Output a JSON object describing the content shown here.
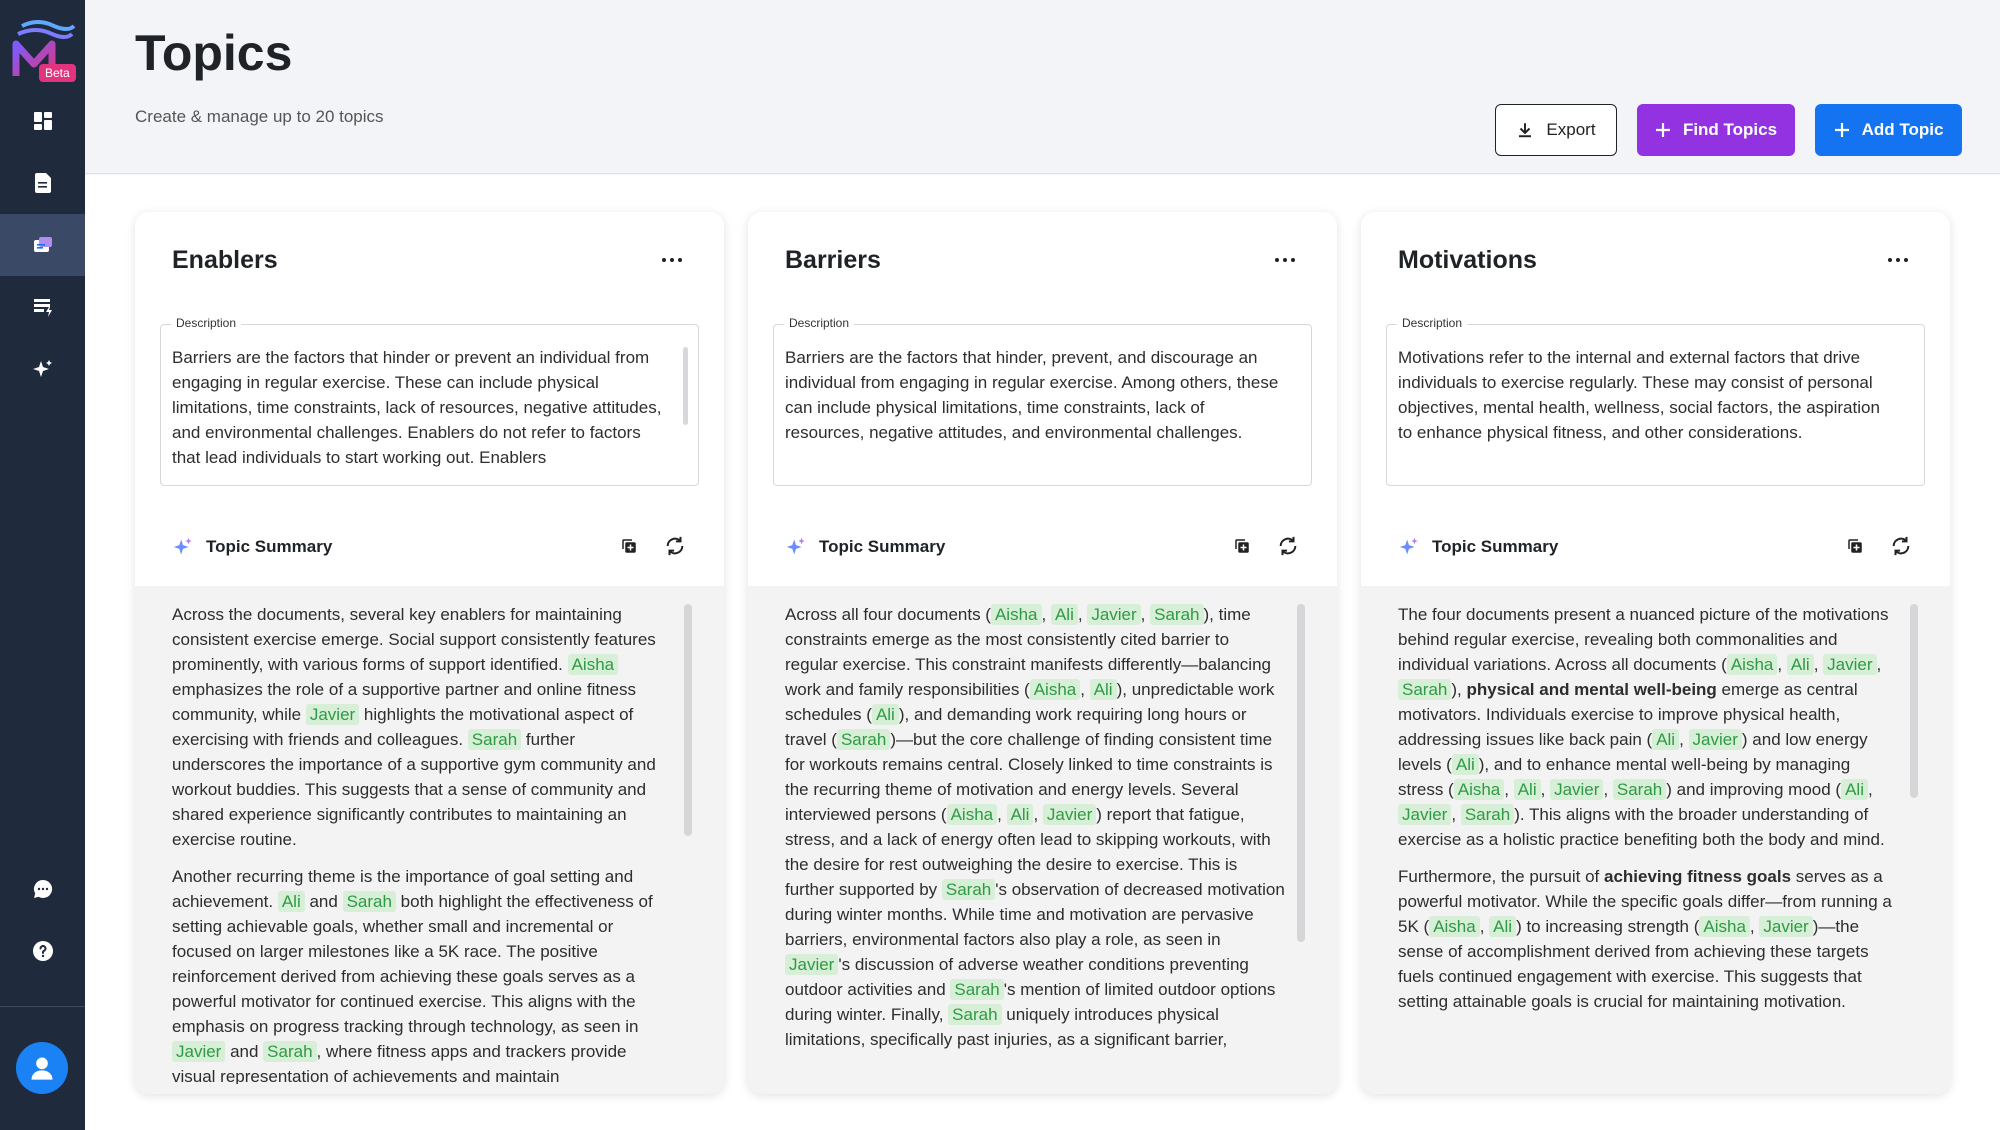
{
  "app": {
    "beta_label": "Beta"
  },
  "sidebar": {
    "items": [
      {
        "name": "dashboard-icon"
      },
      {
        "name": "documents-icon"
      },
      {
        "name": "topics-icon",
        "active": true
      },
      {
        "name": "table-lightning-icon"
      },
      {
        "name": "sparkle-icon"
      }
    ],
    "bottom": [
      {
        "name": "chat-icon"
      },
      {
        "name": "help-icon"
      },
      {
        "name": "user-avatar-icon"
      }
    ]
  },
  "header": {
    "title": "Topics",
    "subtitle": "Create & manage up to 20 topics",
    "export_label": "Export",
    "find_label": "Find Topics",
    "add_label": "Add Topic"
  },
  "colors": {
    "accent_purple": "#9232e0",
    "accent_blue": "#1473f0",
    "tag_bg": "#d7efd6",
    "tag_text": "#2f9a45",
    "sidebar": "#1f2a3d"
  },
  "cards": [
    {
      "title": "Enablers",
      "description_label": "Description",
      "description": "Barriers are the factors that hinder or prevent an individual from engaging in regular exercise. These can include physical limitations, time constraints, lack of resources, negative attitudes, and environmental challenges. Enablers do not refer to factors that lead individuals to start working out. Enablers",
      "summary_label": "Topic Summary",
      "summary_html": "<p>Across the documents, several key enablers for maintaining consistent exercise emerge. Social support consistently features prominently, with various forms of support identified. <span class=\"tag\">Aisha</span> emphasizes the role of a supportive partner and online fitness community, while <span class=\"tag\">Javier</span> highlights the motivational aspect of exercising with friends and colleagues. <span class=\"tag\">Sarah</span> further underscores the importance of a supportive gym community and workout buddies. This suggests that a sense of community and shared experience significantly contributes to maintaining an exercise routine.</p><p>Another recurring theme is the importance of goal setting and achievement. <span class=\"tag\">Ali</span> and <span class=\"tag\">Sarah</span> both highlight the effectiveness of setting achievable goals, whether small and incremental or focused on larger milestones like a 5K race. The positive reinforcement derived from achieving these goals serves as a powerful motivator for continued exercise. This aligns with the emphasis on progress tracking through technology, as seen in <span class=\"tag\">Javier</span> and <span class=\"tag\">Sarah</span>, where fitness apps and trackers provide visual representation of achievements and maintain</p>"
    },
    {
      "title": "Barriers",
      "description_label": "Description",
      "description": "Barriers are the factors that hinder, prevent, and discourage an individual from engaging in regular exercise. Among others, these can include physical limitations, time constraints, lack of resources, negative attitudes, and environmental challenges.",
      "summary_label": "Topic Summary",
      "summary_html": "<p>Across all four documents (<span class=\"tag\">Aisha</span>, <span class=\"tag\">Ali</span>, <span class=\"tag\">Javier</span>, <span class=\"tag\">Sarah</span>), time constraints emerge as the most consistently cited barrier to regular exercise. This constraint manifests differently—balancing work and family responsibilities (<span class=\"tag\">Aisha</span>, <span class=\"tag\">Ali</span>), unpredictable work schedules (<span class=\"tag\">Ali</span>), and demanding work requiring long hours or travel (<span class=\"tag\">Sarah</span>)—but the core challenge of finding consistent time for workouts remains central. Closely linked to time constraints is the recurring theme of motivation and energy levels. Several interviewed persons (<span class=\"tag\">Aisha</span>, <span class=\"tag\">Ali</span>, <span class=\"tag\">Javier</span>) report that fatigue, stress, and a lack of energy often lead to skipping workouts, with the desire for rest outweighing the desire to exercise. This is further supported by <span class=\"tag\">Sarah</span>'s observation of decreased motivation during winter months. While time and motivation are pervasive barriers, environmental factors also play a role, as seen in <span class=\"tag\">Javier</span>'s discussion of adverse weather conditions preventing outdoor activities and <span class=\"tag\">Sarah</span>'s mention of limited outdoor options during winter. Finally, <span class=\"tag\">Sarah</span> uniquely introduces physical limitations, specifically past injuries, as a significant barrier,</p>"
    },
    {
      "title": "Motivations",
      "description_label": "Description",
      "description": "Motivations refer to the internal and external factors that drive individuals to exercise regularly. These may consist of personal objectives, mental health, wellness, social factors, the aspiration to enhance physical fitness, and other considerations.",
      "summary_label": "Topic Summary",
      "summary_html": "<p>The four documents present a nuanced picture of the motivations behind regular exercise, revealing both commonalities and individual variations. Across all documents (<span class=\"tag\">Aisha</span>, <span class=\"tag\">Ali</span>, <span class=\"tag\">Javier</span>, <span class=\"tag\">Sarah</span>), <b>physical and mental well-being</b> emerge as central motivators. Individuals exercise to improve physical health, addressing issues like back pain (<span class=\"tag\">Ali</span>, <span class=\"tag\">Javier</span>) and low energy levels (<span class=\"tag\">Ali</span>), and to enhance mental well-being by managing stress (<span class=\"tag\">Aisha</span>, <span class=\"tag\">Ali</span>, <span class=\"tag\">Javier</span>, <span class=\"tag\">Sarah</span>) and improving mood (<span class=\"tag\">Ali</span>, <span class=\"tag\">Javier</span>, <span class=\"tag\">Sarah</span>). This aligns with the broader understanding of exercise as a holistic practice benefiting both the body and mind.</p><p>Furthermore, the pursuit of <b>achieving fitness goals</b> serves as a powerful motivator. While the specific goals differ—from running a 5K (<span class=\"tag\">Aisha</span>, <span class=\"tag\">Ali</span>) to increasing strength (<span class=\"tag\">Aisha</span>, <span class=\"tag\">Javier</span>)—the sense of accomplishment derived from achieving these targets fuels continued engagement with exercise. This suggests that setting attainable goals is crucial for maintaining motivation.</p>"
    }
  ]
}
